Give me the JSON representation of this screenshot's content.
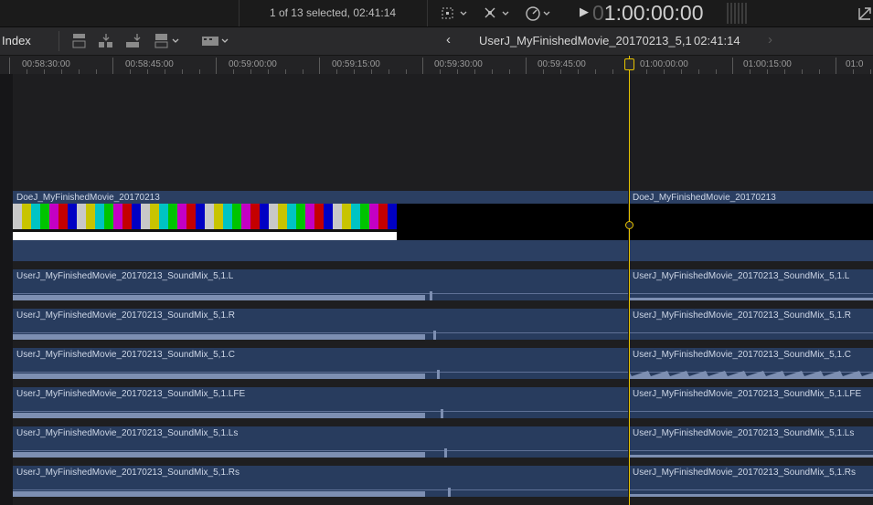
{
  "toolbar": {
    "selection_status": "1 of 13 selected, 02:41:14",
    "timecode_dim": "0",
    "timecode_main": "1:00:00:00",
    "play_icon": "play-icon"
  },
  "secondary_bar": {
    "index_label": "Index",
    "project_title": "UserJ_MyFinishedMovie_20170213_5,1",
    "project_duration": "02:41:14",
    "nav_prev": "‹",
    "nav_next": "›"
  },
  "ruler": {
    "labels": [
      "00:58:30:00",
      "00:58:45:00",
      "00:59:00:00",
      "00:59:15:00",
      "00:59:30:00",
      "00:59:45:00",
      "01:00:00:00",
      "01:00:15:00",
      "01:0"
    ]
  },
  "clips": {
    "video_left": "DoeJ_MyFinishedMovie_20170213",
    "video_right": "DoeJ_MyFinishedMovie_20170213",
    "audio": [
      {
        "left": "UserJ_MyFinishedMovie_20170213_SoundMix_5,1.L",
        "right": "UserJ_MyFinishedMovie_20170213_SoundMix_5,1.L"
      },
      {
        "left": "UserJ_MyFinishedMovie_20170213_SoundMix_5,1.R",
        "right": "UserJ_MyFinishedMovie_20170213_SoundMix_5,1.R"
      },
      {
        "left": "UserJ_MyFinishedMovie_20170213_SoundMix_5,1.C",
        "right": "UserJ_MyFinishedMovie_20170213_SoundMix_5,1.C"
      },
      {
        "left": "UserJ_MyFinishedMovie_20170213_SoundMix_5,1.LFE",
        "right": "UserJ_MyFinishedMovie_20170213_SoundMix_5,1.LFE"
      },
      {
        "left": "UserJ_MyFinishedMovie_20170213_SoundMix_5,1.Ls",
        "right": "UserJ_MyFinishedMovie_20170213_SoundMix_5,1.Ls"
      },
      {
        "left": "UserJ_MyFinishedMovie_20170213_SoundMix_5,1.Rs",
        "right": "UserJ_MyFinishedMovie_20170213_SoundMix_5,1.Rs"
      }
    ]
  },
  "colors": {
    "playhead": "#e6c200",
    "clip_blue": "#2b3f62",
    "colorbars": [
      "#c8c8c8",
      "#c8c400",
      "#00c4c4",
      "#00c400",
      "#c400c4",
      "#c40000",
      "#0000c4"
    ]
  }
}
